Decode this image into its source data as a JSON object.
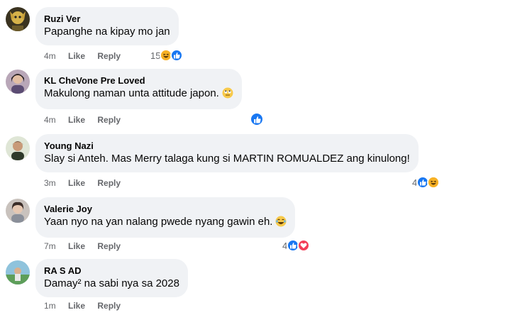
{
  "comments": [
    {
      "author": "Ruzi Ver",
      "text": "Papanghe na kipay mo jan",
      "time": "4m",
      "like_label": "Like",
      "reply_label": "Reply",
      "reaction_count": "15",
      "reactions": [
        "haha",
        "like"
      ]
    },
    {
      "author": "KL CheVone Pre Loved",
      "text": "Makulong naman unta attitude japon.",
      "time": "4m",
      "like_label": "Like",
      "reply_label": "Reply",
      "reaction_count": "",
      "reactions": [
        "like"
      ]
    },
    {
      "author": "Young Nazi",
      "text": "Slay si Anteh. Mas Merry talaga kung si MARTIN ROMUALDEZ ang kinulong!",
      "time": "3m",
      "like_label": "Like",
      "reply_label": "Reply",
      "reaction_count": "4",
      "reactions": [
        "like",
        "haha"
      ]
    },
    {
      "author": "Valerie Joy",
      "text": "Yaan nyo na yan nalang pwede nyang gawin eh.",
      "time": "7m",
      "like_label": "Like",
      "reply_label": "Reply",
      "reaction_count": "4",
      "reactions": [
        "like",
        "love"
      ]
    },
    {
      "author": "RA S AD",
      "text": "Damay² na sabi nya sa 2028",
      "time": "1m",
      "like_label": "Like",
      "reply_label": "Reply",
      "reaction_count": "",
      "reactions": []
    }
  ],
  "colors": {
    "bubble": "#f0f2f5",
    "meta": "#65676b",
    "like": "#1877f2",
    "haha": "#f7b125",
    "love": "#f33e58"
  }
}
